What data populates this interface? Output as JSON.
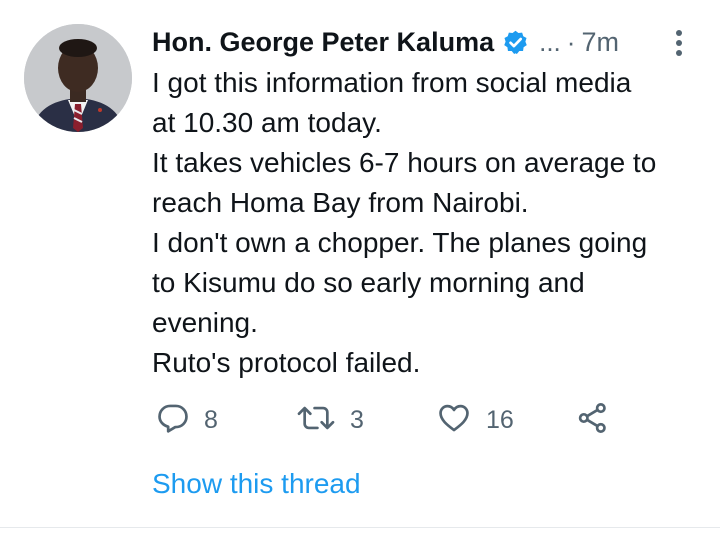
{
  "tweet": {
    "author_name": "Hon. George Peter Kaluma",
    "ellipsis": "...",
    "separator": "·",
    "time": "7m",
    "lines": [
      "I got this information from social media",
      "at 10.30 am today.",
      "It takes vehicles 6-7 hours on average to",
      "reach Homa Bay from Nairobi.",
      "I don't own a chopper. The planes going",
      "to Kisumu do so early morning and",
      "evening.",
      "Ruto's protocol failed."
    ],
    "replies": "8",
    "retweets": "3",
    "likes": "16",
    "show_thread": "Show this thread"
  },
  "icons": {
    "verified": "verified-badge-icon",
    "more": "more-vertical-icon",
    "reply": "reply-icon",
    "retweet": "retweet-icon",
    "like": "heart-icon",
    "share": "share-icon"
  },
  "colors": {
    "accent": "#1d9bf0",
    "muted": "#536471",
    "text": "#0f1419"
  }
}
